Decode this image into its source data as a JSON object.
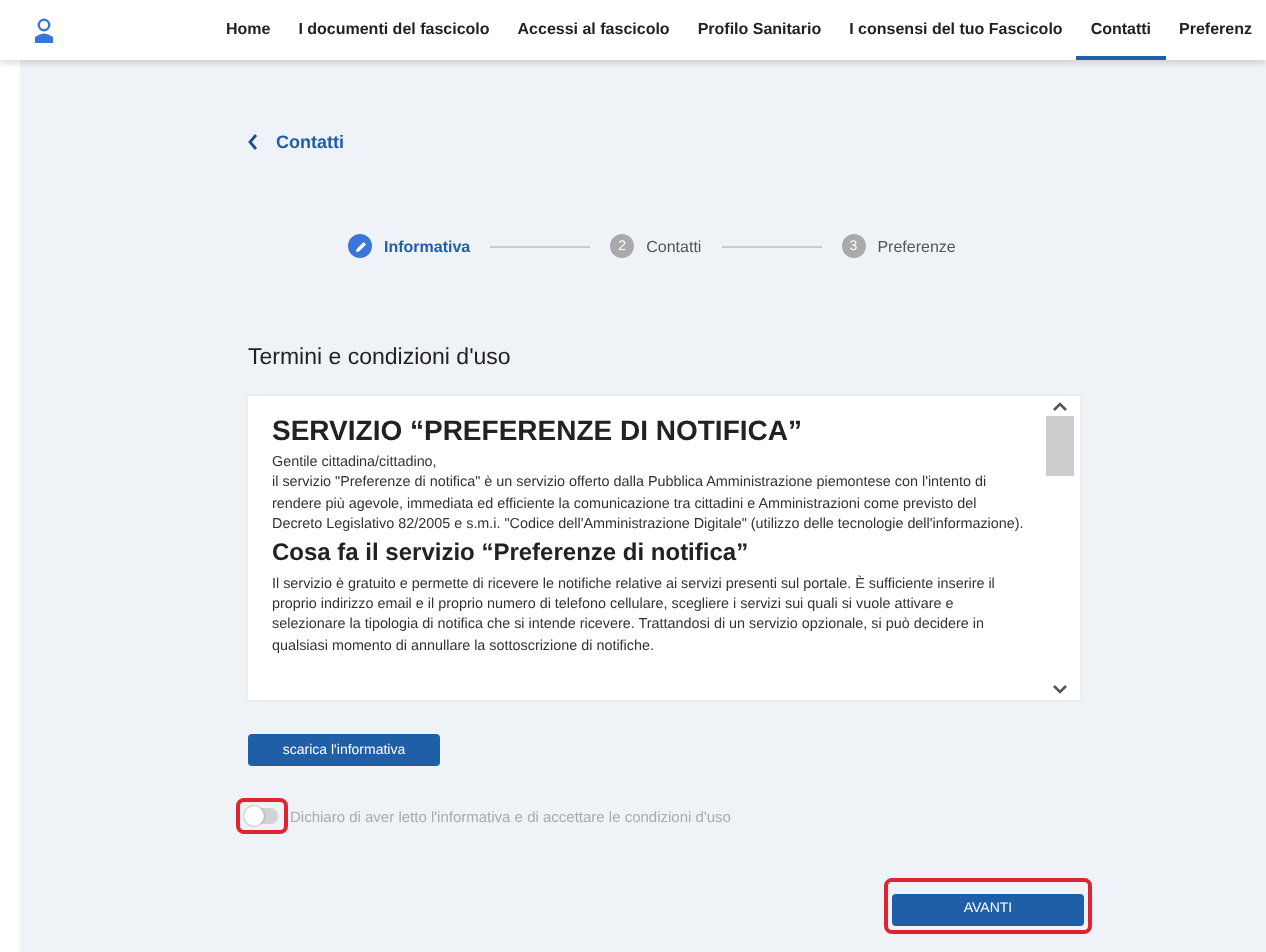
{
  "nav": {
    "items": [
      {
        "label": "Home",
        "selected": false
      },
      {
        "label": "I documenti del fascicolo",
        "selected": false
      },
      {
        "label": "Accessi al fascicolo",
        "selected": false
      },
      {
        "label": "Profilo Sanitario",
        "selected": false
      },
      {
        "label": "I consensi del tuo Fascicolo",
        "selected": false
      },
      {
        "label": "Contatti",
        "selected": true
      },
      {
        "label": "Preferenz",
        "selected": false
      }
    ]
  },
  "back_link": {
    "label": "Contatti"
  },
  "stepper": [
    {
      "label": "Informativa",
      "selected": true
    },
    {
      "label": "Contatti",
      "number": "2",
      "selected": false
    },
    {
      "label": "Preferenze",
      "number": "3",
      "selected": false
    }
  ],
  "section_title": "Termini e condizioni d'uso",
  "terms": {
    "title": "SERVIZIO “PREFERENZE DI NOTIFICA”",
    "blocks": [
      {
        "kind": "paragraph",
        "text": "Gentile cittadina/cittadino,"
      },
      {
        "kind": "paragraph",
        "text": "il servizio \"Preferenze di notifica\" è un servizio offerto dalla Pubblica Amministrazione piemontese con l'intento di rendere più agevole, immediata ed efficiente la comunicazione tra cittadini e Amministrazioni come previsto del Decreto Legislativo 82/2005 e s.m.i. \"Codice dell'Amministrazione Digitale\" (utilizzo delle tecnologie dell'informazione)."
      },
      {
        "kind": "heading",
        "text": "Cosa fa il servizio “Preferenze di notifica”"
      },
      {
        "kind": "paragraph",
        "text": "Il servizio è gratuito e permette di ricevere le notifiche relative ai servizi presenti sul portale. È sufficiente inserire il proprio indirizzo email e il proprio numero di telefono cellulare, scegliere i servizi sui quali si vuole attivare e selezionare la tipologia di notifica che si intende ricevere. Trattandosi di un servizio opzionale, si può decidere in qualsiasi momento di annullare la sottoscrizione di notifiche."
      }
    ]
  },
  "download_button": {
    "label": "scarica l'informativa"
  },
  "consent": {
    "label": "Dichiaro di aver letto l'informativa e di accettare le condizioni d'uso",
    "on": false,
    "highlighted": true
  },
  "next_button": {
    "label": "AVANTI",
    "highlighted": true
  }
}
